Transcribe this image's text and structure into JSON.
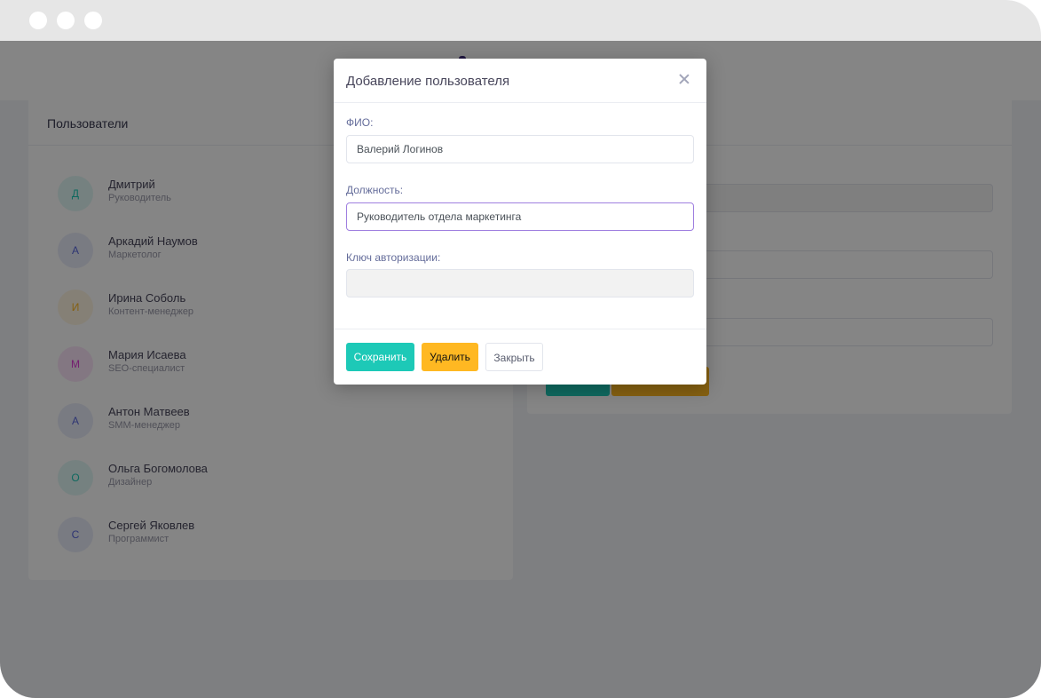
{
  "modal": {
    "title": "Добавление пользователя",
    "fields": {
      "fio": {
        "label": "ФИО:",
        "value": "Валерий Логинов"
      },
      "position": {
        "label": "Должность:",
        "value": "Руководитель отдела маркетинга"
      },
      "auth_key": {
        "label": "Ключ авторизации:",
        "value": ""
      }
    },
    "buttons": {
      "save": "Сохранить",
      "delete": "Удалить",
      "close": "Закрыть"
    }
  },
  "users_panel": {
    "title": "Пользователи",
    "users": [
      {
        "initial": "Д",
        "name": "Дмитрий",
        "role": "Руководитель",
        "color": "#1dc9b7"
      },
      {
        "initial": "А",
        "name": "Аркадий Наумов",
        "role": "Маркетолог",
        "color": "#5867dd"
      },
      {
        "initial": "И",
        "name": "Ирина Соболь",
        "role": "Контент-менеджер",
        "color": "#ffb822"
      },
      {
        "initial": "М",
        "name": "Мария Исаева",
        "role": "SEO-специалист",
        "color": "#e03ad6"
      },
      {
        "initial": "А",
        "name": "Антон Матвеев",
        "role": "SMM-менеджер",
        "color": "#5867dd"
      },
      {
        "initial": "О",
        "name": "Ольга Богомолова",
        "role": "Дизайнер",
        "color": "#1dc9b7"
      },
      {
        "initial": "С",
        "name": "Сергей Яковлев",
        "role": "Программист",
        "color": "#5867dd"
      }
    ]
  },
  "colors": {
    "accent_success": "#1dc9b7",
    "accent_warning": "#ffb822",
    "focus_border": "#9f7fe0"
  }
}
